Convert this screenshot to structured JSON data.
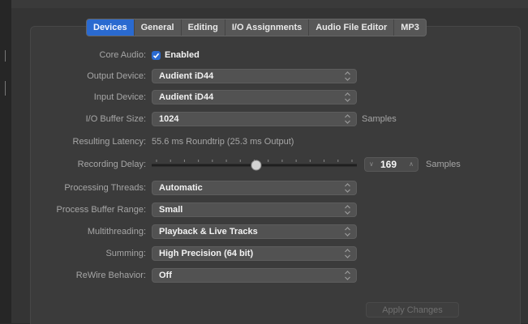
{
  "tabs": [
    {
      "label": "Devices",
      "active": true
    },
    {
      "label": "General",
      "active": false
    },
    {
      "label": "Editing",
      "active": false
    },
    {
      "label": "I/O Assignments",
      "active": false
    },
    {
      "label": "Audio File Editor",
      "active": false
    },
    {
      "label": "MP3",
      "active": false
    }
  ],
  "core_audio": {
    "label": "Core Audio:",
    "checkbox_label": "Enabled",
    "checked": true
  },
  "output_device": {
    "label": "Output Device:",
    "value": "Audient iD44"
  },
  "input_device": {
    "label": "Input Device:",
    "value": "Audient iD44"
  },
  "io_buffer": {
    "label": "I/O Buffer Size:",
    "value": "1024",
    "unit": "Samples"
  },
  "latency": {
    "label": "Resulting Latency:",
    "value": "55.6 ms Roundtrip (25.3 ms Output)"
  },
  "recording_delay": {
    "label": "Recording Delay:",
    "value": "169",
    "unit": "Samples",
    "slider_fraction": 0.51
  },
  "processing_threads": {
    "label": "Processing Threads:",
    "value": "Automatic"
  },
  "process_buffer": {
    "label": "Process Buffer Range:",
    "value": "Small"
  },
  "multithreading": {
    "label": "Multithreading:",
    "value": "Playback & Live Tracks"
  },
  "summing": {
    "label": "Summing:",
    "value": "High Precision (64 bit)"
  },
  "rewire": {
    "label": "ReWire Behavior:",
    "value": "Off"
  },
  "apply_button": {
    "label": "Apply Changes",
    "enabled": false
  },
  "colors": {
    "accent": "#2a6ad0",
    "panel": "#3b3b3b",
    "control": "#525252"
  },
  "icons": {
    "stepper": "up-down-chevron-icon",
    "check": "checkmark-icon"
  }
}
